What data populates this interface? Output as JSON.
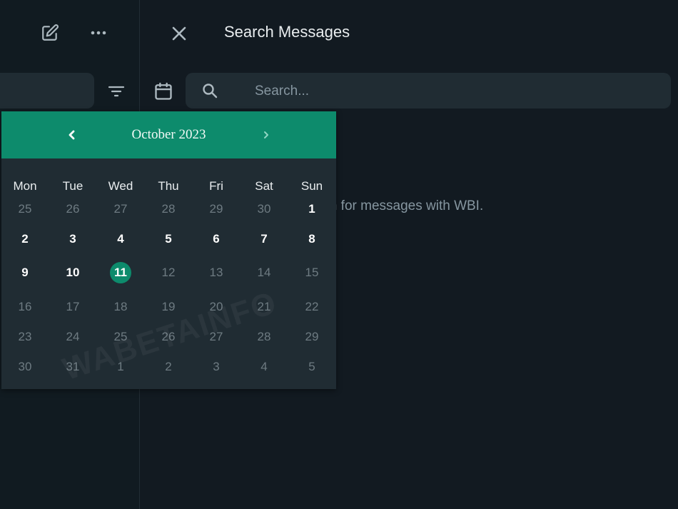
{
  "header": {
    "title": "Search Messages"
  },
  "search": {
    "placeholder": "Search..."
  },
  "hint": {
    "text": "rch for messages with WBI."
  },
  "calendar": {
    "month_label": "October 2023",
    "weekdays": [
      "Mon",
      "Tue",
      "Wed",
      "Thu",
      "Fri",
      "Sat",
      "Sun"
    ],
    "weeks": [
      [
        "25",
        "26",
        "27",
        "28",
        "29",
        "30",
        "1"
      ],
      [
        "2",
        "3",
        "4",
        "5",
        "6",
        "7",
        "8"
      ],
      [
        "9",
        "10",
        "11",
        "12",
        "13",
        "14",
        "15"
      ],
      [
        "16",
        "17",
        "18",
        "19",
        "20",
        "21",
        "22"
      ],
      [
        "23",
        "24",
        "25",
        "26",
        "27",
        "28",
        "29"
      ],
      [
        "30",
        "31",
        "1",
        "2",
        "3",
        "4",
        "5"
      ]
    ],
    "selected_day": "11",
    "accent_color": "#0d8b6c"
  },
  "watermark": {
    "text": "WABETAINFO"
  }
}
